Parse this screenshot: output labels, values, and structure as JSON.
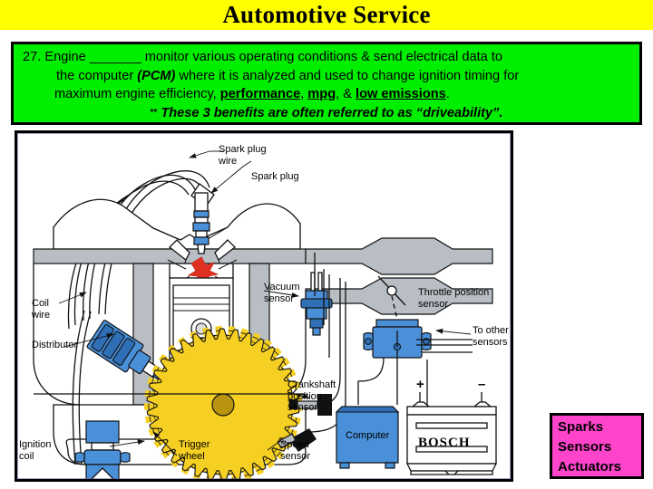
{
  "slide": {
    "title": "Automotive Service",
    "title_bg": "#ffff00",
    "background": "#ffffff"
  },
  "statement": {
    "bg": "#00ee00",
    "border": "#000000",
    "number": "27.",
    "line1_a": "27.  Engine ",
    "line1_blank": "_______",
    "line1_b": " monitor various operating conditions & send electrical data to",
    "line2_a": "the computer ",
    "line2_pcm": "(PCM)",
    "line2_b": " where it is analyzed and used to change ignition timing for",
    "line3_a": "maximum engine efficiency, ",
    "line3_t1": "performance",
    "line3_c1": ", ",
    "line3_t2": "mpg",
    "line3_c2": ", & ",
    "line3_t3": "low  emissions",
    "line3_end": ".",
    "line4_stars": "**",
    "line4_text": " These 3 benefits are often referred to as “driveability”."
  },
  "diagram": {
    "frame_border": "#000000",
    "colors": {
      "component_blue": "#4a90d9",
      "gear_yellow": "#f5cf21",
      "spark_red": "#e03020",
      "metal_gray": "#b9bec4"
    },
    "labels": [
      {
        "name": "spark-plug-wire",
        "text": "Spark plug\nwire"
      },
      {
        "name": "spark-plug",
        "text": "Spark plug"
      },
      {
        "name": "vacuum-sensor",
        "text": "Vacuum\nsensor"
      },
      {
        "name": "throttle-position-sensor",
        "text": "Throttle position\nsensor"
      },
      {
        "name": "coil-wire",
        "text": "Coil\nwire"
      },
      {
        "name": "distributor",
        "text": "Distributor"
      },
      {
        "name": "to-other-sensors",
        "text": "To other\nsensors"
      },
      {
        "name": "crankshaft-position-sensor",
        "text": "Crankshaft\nposition\nsensor"
      },
      {
        "name": "ignition-coil",
        "text": "Ignition\ncoil"
      },
      {
        "name": "trigger-wheel",
        "text": "Trigger\nwheel"
      },
      {
        "name": "speed-sensor",
        "text": "Speed\nsensor"
      },
      {
        "name": "computer",
        "text": "Computer"
      },
      {
        "name": "battery-brand",
        "text": "BOSCH"
      },
      {
        "name": "battery-plus",
        "text": "+"
      },
      {
        "name": "battery-minus",
        "text": "–"
      }
    ]
  },
  "callout": {
    "bg": "#ff44cc",
    "border": "#000000",
    "line1": "Sparks",
    "line2": "Sensors",
    "line3": "Actuators"
  }
}
